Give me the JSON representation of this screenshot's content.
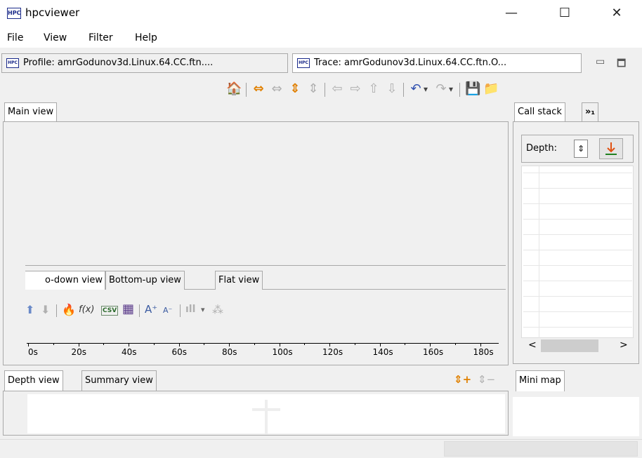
{
  "window": {
    "app_icon_text": "HPC",
    "title": "hpcviewer",
    "controls": {
      "minimize": "—",
      "maximize": "☐",
      "close": "✕"
    }
  },
  "menu": {
    "items": [
      "File",
      "View",
      "Filter",
      "Help"
    ]
  },
  "editor_tabs": [
    {
      "label": "Profile: amrGodunov3d.Linux.64.CC.ftn....",
      "active": false
    },
    {
      "label": "Trace: amrGodunov3d.Linux.64.CC.ftn.O...",
      "active": true
    }
  ],
  "editor_controls": {
    "minimize": "▭",
    "maximize": "🗖"
  },
  "toolbar": {
    "icons": {
      "home": "🏠",
      "expand_h": "⇔",
      "shrink_h": "⇔",
      "expand_v": "⇕",
      "shrink_v": "⇕",
      "left": "⇦",
      "right": "⇨",
      "up": "⇧",
      "down": "⇩",
      "undo": "↶",
      "dropdown": "▾",
      "redo": "↷",
      "save": "💾",
      "open": "📁"
    }
  },
  "main_view": {
    "tab_label": "Main view",
    "sub_tabs": [
      "o-down view",
      "Bottom-up view",
      "Flat view"
    ],
    "sub_toolbar": {
      "icons": {
        "up": "⬆",
        "down": "⬇",
        "hot_path": "🔥",
        "formula": "f(x)",
        "csv": "CSV",
        "columns": "▦",
        "font_up": "A⁺",
        "font_down": "A⁻",
        "graph": "ıll",
        "dropdown": "▾",
        "plugin": "⁂"
      }
    },
    "ruler": {
      "labels": [
        "0s",
        "20s",
        "40s",
        "60s",
        "80s",
        "100s",
        "120s",
        "140s",
        "160s",
        "180s"
      ]
    }
  },
  "call_stack": {
    "tab_label": "Call stack",
    "overflow_label": "»₁",
    "depth_label": "Depth:",
    "spinner_icon": "⇕",
    "scroll_left": "<",
    "scroll_right": ">"
  },
  "depth_panel": {
    "tabs": [
      "Depth view",
      "Summary view"
    ],
    "zoom_in_icon": "⇕+",
    "zoom_out_icon": "⇕−"
  },
  "mini_map": {
    "label": "Mini map"
  }
}
